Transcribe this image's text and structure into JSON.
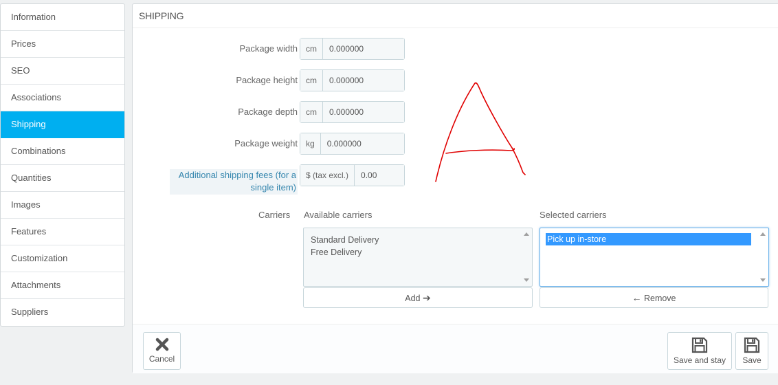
{
  "sidebar": {
    "items": [
      {
        "label": "Information",
        "active": false
      },
      {
        "label": "Prices",
        "active": false
      },
      {
        "label": "SEO",
        "active": false
      },
      {
        "label": "Associations",
        "active": false
      },
      {
        "label": "Shipping",
        "active": true
      },
      {
        "label": "Combinations",
        "active": false
      },
      {
        "label": "Quantities",
        "active": false
      },
      {
        "label": "Images",
        "active": false
      },
      {
        "label": "Features",
        "active": false
      },
      {
        "label": "Customization",
        "active": false
      },
      {
        "label": "Attachments",
        "active": false
      },
      {
        "label": "Suppliers",
        "active": false
      }
    ]
  },
  "panel": {
    "title": "SHIPPING",
    "fields": {
      "width": {
        "label": "Package width",
        "unit": "cm",
        "value": "0.000000"
      },
      "height": {
        "label": "Package height",
        "unit": "cm",
        "value": "0.000000"
      },
      "depth": {
        "label": "Package depth",
        "unit": "cm",
        "value": "0.000000"
      },
      "weight": {
        "label": "Package weight",
        "unit": "kg",
        "value": "0.000000"
      },
      "fees": {
        "label_line1": "Additional shipping fees (for a",
        "label_line2": "single item)",
        "unit": "$ (tax excl.)",
        "value": "0.00"
      }
    },
    "carriers": {
      "label": "Carriers",
      "available_title": "Available carriers",
      "available": [
        "Standard Delivery",
        "Free Delivery"
      ],
      "selected_title": "Selected carriers",
      "selected": [
        "Pick up in-store"
      ],
      "add_label": "Add",
      "remove_label": "Remove"
    }
  },
  "footer": {
    "cancel_label": "Cancel",
    "save_stay_label": "Save and stay",
    "save_label": "Save"
  },
  "colors": {
    "accent": "#00aff0",
    "annotation": "#e00000",
    "selection": "#3399ff"
  }
}
